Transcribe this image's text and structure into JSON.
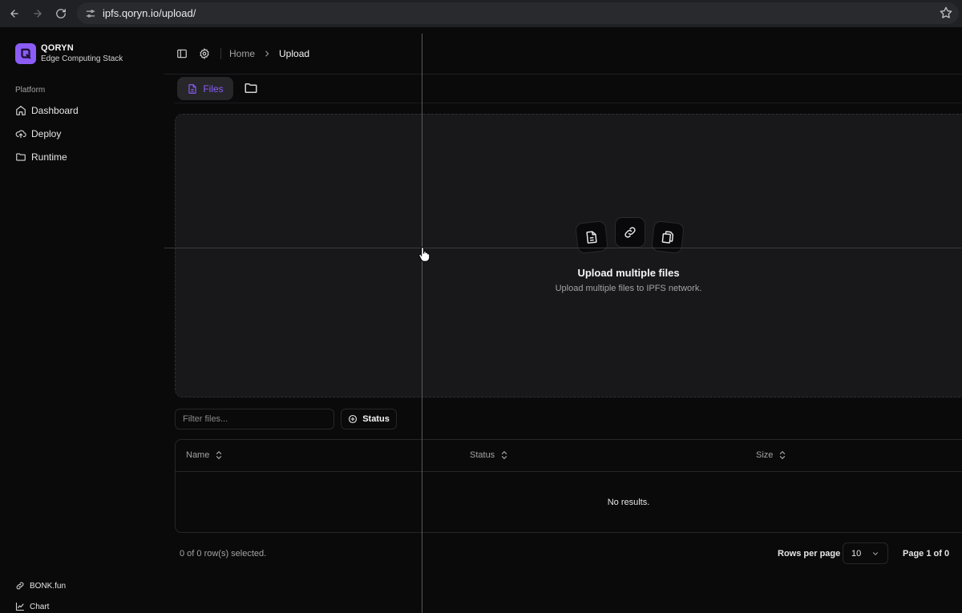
{
  "browser": {
    "url": "ipfs.qoryn.io/upload/"
  },
  "sidebar": {
    "brand_name": "QORYN",
    "brand_sub": "Edge Computing Stack",
    "section_label": "Platform",
    "items": [
      {
        "label": "Dashboard",
        "icon": "home-icon"
      },
      {
        "label": "Deploy",
        "icon": "cloud-upload-icon"
      },
      {
        "label": "Runtime",
        "icon": "folder-icon"
      }
    ],
    "bottom_items": [
      {
        "label": "BONK.fun",
        "icon": "link-icon"
      },
      {
        "label": "Chart",
        "icon": "chart-line-icon"
      }
    ]
  },
  "header": {
    "breadcrumb_home": "Home",
    "breadcrumb_current": "Upload"
  },
  "tabs": {
    "files_label": "Files"
  },
  "dropzone": {
    "title": "Upload multiple files",
    "subtitle": "Upload multiple files to IPFS network."
  },
  "filter": {
    "placeholder": "Filter files...",
    "status_label": "Status"
  },
  "table": {
    "columns": [
      "Name",
      "Status",
      "Size"
    ],
    "empty_text": "No results."
  },
  "footer": {
    "selection_text": "0 of 0 row(s) selected.",
    "rows_per_page_label": "Rows per page",
    "rows_per_page_value": "10",
    "page_text": "Page 1 of 0"
  },
  "colors": {
    "accent": "#8b5cf6",
    "background": "#0a0a0b",
    "dropzone_bg": "#18181b"
  }
}
